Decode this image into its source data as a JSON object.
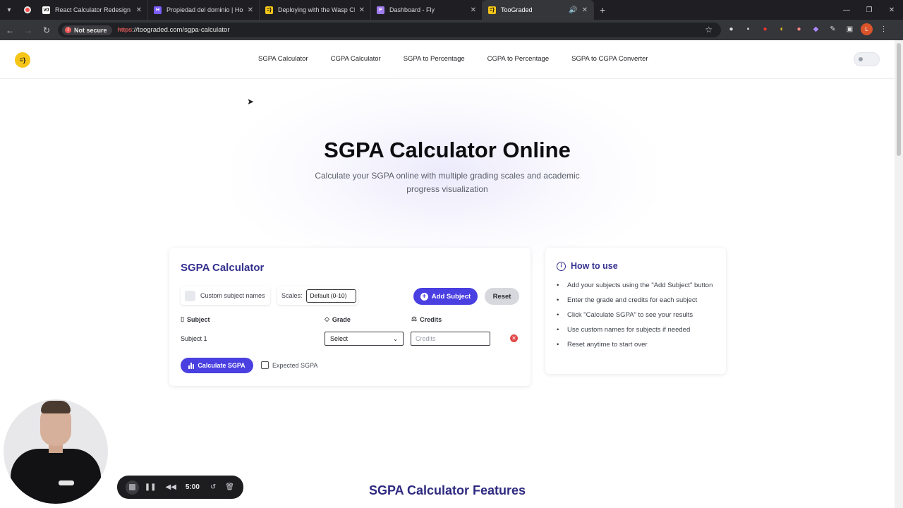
{
  "browser": {
    "tabs": [
      {
        "title": "React Calculator Redesign - v0",
        "fav": "v0",
        "fav_color": "#ffffff"
      },
      {
        "title": "Propiedad del dominio | Hostin",
        "fav": "H",
        "fav_color": "#7b5cff"
      },
      {
        "title": "Deploying with the Wasp CLI | W",
        "fav": "=}",
        "fav_color": "#f5c518"
      },
      {
        "title": "Dashboard - Fly",
        "fav": "F",
        "fav_color": "#a07cf0"
      },
      {
        "title": "TooGraded",
        "fav": "=}",
        "fav_color": "#f5c518"
      }
    ],
    "security_label": "Not secure",
    "url_scheme": "https",
    "url_rest": "://toograded.com/sgpa-calculator"
  },
  "header": {
    "logo": "=}",
    "nav": [
      "SGPA Calculator",
      "CGPA Calculator",
      "SGPA to Percentage",
      "CGPA to Percentage",
      "SGPA to CGPA Converter"
    ]
  },
  "hero": {
    "title": "SGPA Calculator Online",
    "subtitle": "Calculate your SGPA online with multiple grading scales and academic progress visualization"
  },
  "calculator": {
    "title": "SGPA Calculator",
    "custom_names_label": "Custom subject names",
    "scales_label": "Scales:",
    "scales_value": "Default (0-10)",
    "add_subject": "Add Subject",
    "reset": "Reset",
    "columns": {
      "subject": "Subject",
      "grade": "Grade",
      "credits": "Credits"
    },
    "rows": [
      {
        "name": "Subject 1",
        "grade": "Select",
        "credits_placeholder": "Credits"
      }
    ],
    "calculate": "Calculate SGPA",
    "expected_label": "Expected SGPA"
  },
  "howto": {
    "title": "How to use",
    "items": [
      "Add your subjects using the \"Add Subject\" button",
      "Enter the grade and credits for each subject",
      "Click \"Calculate SGPA\" to see your results",
      "Use custom names for subjects if needed",
      "Reset anytime to start over"
    ]
  },
  "features_title": "SGPA Calculator Features",
  "recorder": {
    "time": "5:00"
  },
  "colors": {
    "accent": "#4a3fe0",
    "heading": "#34308f",
    "logo": "#f5c518"
  }
}
